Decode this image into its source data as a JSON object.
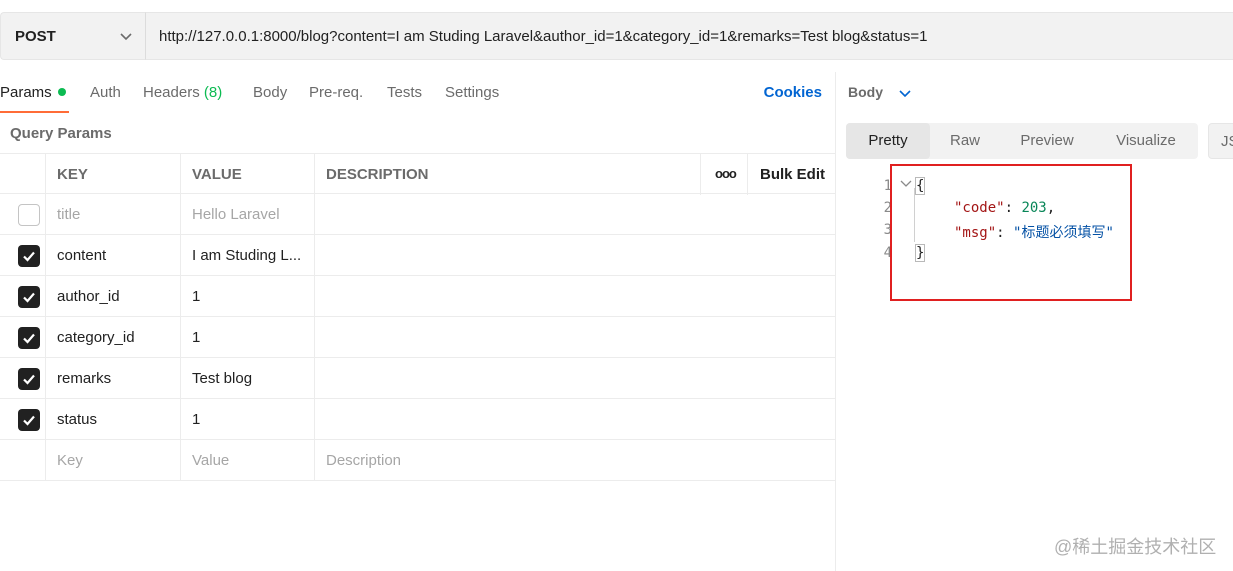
{
  "request": {
    "method": "POST",
    "url": "http://127.0.0.1:8000/blog?content=I am Studing Laravel&author_id=1&category_id=1&remarks=Test blog&status=1"
  },
  "tabs": {
    "params": "Params",
    "auth": "Auth",
    "headers": "Headers",
    "headers_count": "(8)",
    "body": "Body",
    "prereq": "Pre-req.",
    "tests": "Tests",
    "settings": "Settings",
    "cookies": "Cookies"
  },
  "query_params": {
    "title": "Query Params",
    "columns": {
      "key": "KEY",
      "value": "VALUE",
      "description": "DESCRIPTION"
    },
    "more_icon": "ooo",
    "bulk_edit": "Bulk Edit",
    "rows": [
      {
        "checked": false,
        "key": "title",
        "value": "Hello Laravel"
      },
      {
        "checked": true,
        "key": "content",
        "value": "I am Studing L..."
      },
      {
        "checked": true,
        "key": "author_id",
        "value": "1"
      },
      {
        "checked": true,
        "key": "category_id",
        "value": "1"
      },
      {
        "checked": true,
        "key": "remarks",
        "value": "Test blog"
      },
      {
        "checked": true,
        "key": "status",
        "value": "1"
      }
    ],
    "placeholder": {
      "key": "Key",
      "value": "Value",
      "description": "Description"
    }
  },
  "response": {
    "body_label": "Body",
    "views": [
      "Pretty",
      "Raw",
      "Preview",
      "Visualize"
    ],
    "active_view": "Pretty",
    "format_label": "JS",
    "line_numbers": [
      "1",
      "2",
      "3",
      "4"
    ],
    "open_brace": "{",
    "close_brace": "}",
    "code_key": "\"code\"",
    "code_value": "203",
    "msg_key": "\"msg\"",
    "msg_value": "\"标题必须填写\"",
    "colon": ": ",
    "comma": ","
  },
  "watermark": "@稀土掘金技术社区",
  "colors": {
    "accent": "#ff6c37",
    "green": "#0cbb52",
    "link": "#0265d2",
    "highlight": "#e02020"
  }
}
